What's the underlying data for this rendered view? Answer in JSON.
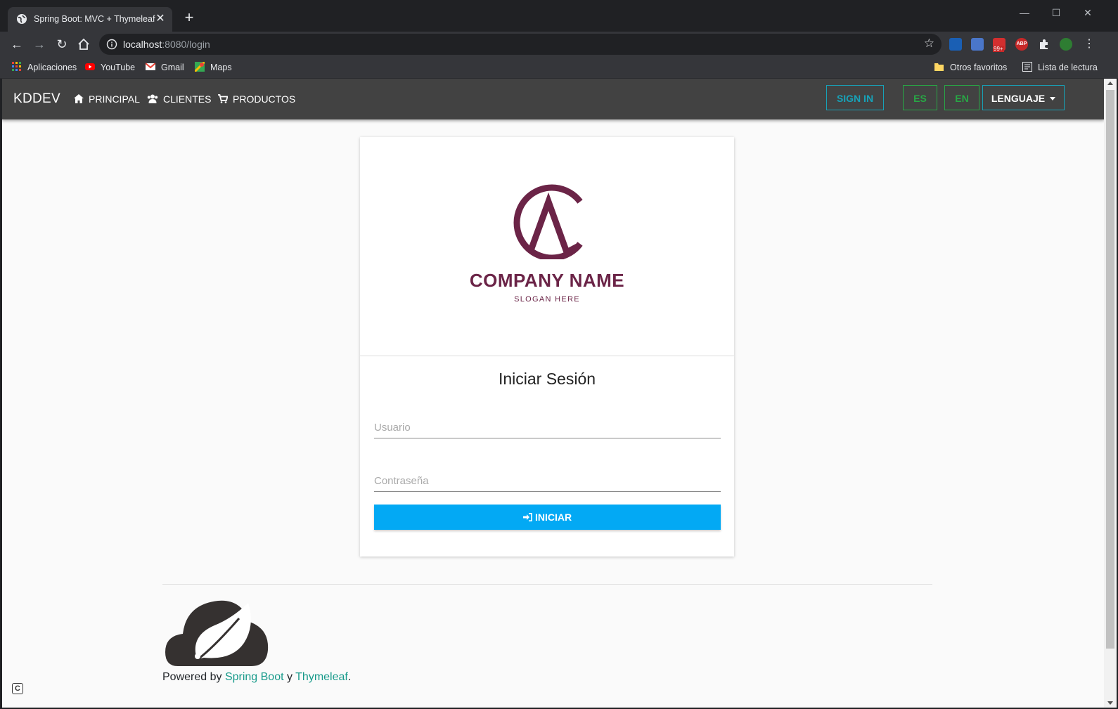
{
  "browser": {
    "tab_title": "Spring Boot: MVC + Thymeleaf +",
    "url_host": "localhost",
    "url_rest": ":8080/login",
    "ext_badge": "99+",
    "ext_abp": "ABP",
    "bookmarks": [
      "Aplicaciones",
      "YouTube",
      "Gmail",
      "Maps"
    ],
    "bookmarks_right": [
      "Otros favoritos",
      "Lista de lectura"
    ]
  },
  "nav": {
    "brand": "KDDEV",
    "links": [
      "PRINCIPAL",
      "CLIENTES",
      "PRODUCTOS"
    ],
    "signin": "SIGN IN",
    "lang_es": "ES",
    "lang_en": "EN",
    "language": "LENGUAJE"
  },
  "login": {
    "company_name": "COMPANY NAME",
    "slogan": "SLOGAN HERE",
    "title": "Iniciar Sesión",
    "username_placeholder": "Usuario",
    "password_placeholder": "Contraseña",
    "submit": "INICIAR"
  },
  "footer": {
    "prefix": "Powered by ",
    "link1": "Spring Boot",
    "middle": " y ",
    "link2": "Thymeleaf",
    "suffix": "."
  },
  "colors": {
    "navbar": "#424242",
    "accent_teal": "#17a2b8",
    "accent_green": "#28a745",
    "button_blue": "#03a9f4",
    "logo": "#6b2447"
  }
}
